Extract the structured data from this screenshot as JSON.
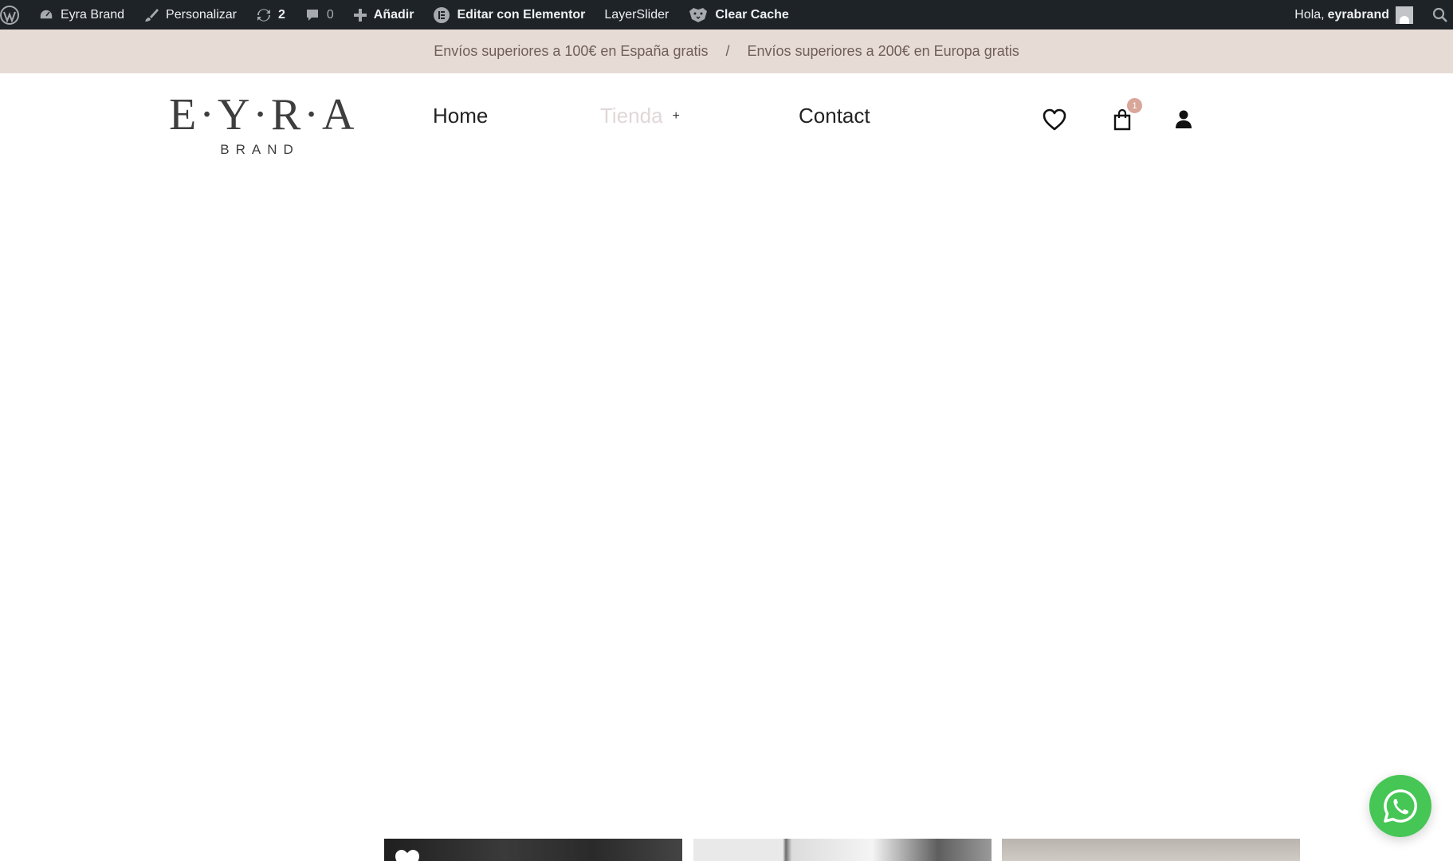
{
  "adminbar": {
    "wp_logo": "wordpress-icon",
    "site_name": "Eyra Brand",
    "customize": "Personalizar",
    "updates_count": "2",
    "comments_count": "0",
    "add_new": "Añadir",
    "elementor": "Editar con Elementor",
    "layerslider": "LayerSlider",
    "clear_cache": "Clear Cache",
    "greeting": "Hola,",
    "username": "eyrabrand"
  },
  "promo": {
    "spain": "Envíos superiores a 100€ en España gratis",
    "separator": "/",
    "europe": "Envíos superiores a 200€ en Europa gratis"
  },
  "header": {
    "logo_main": "E·Y·R·A",
    "logo_sub": "BRAND",
    "nav": {
      "home": "Home",
      "tienda": "Tienda",
      "tienda_toggle": "+",
      "contact": "Contact"
    },
    "cart_count": "1"
  },
  "colors": {
    "adminbar_bg": "#1d2327",
    "promo_bg": "#e7dbd6",
    "promo_text": "#6f5e59",
    "badge": "#d9a69a",
    "whatsapp": "#45c655"
  }
}
